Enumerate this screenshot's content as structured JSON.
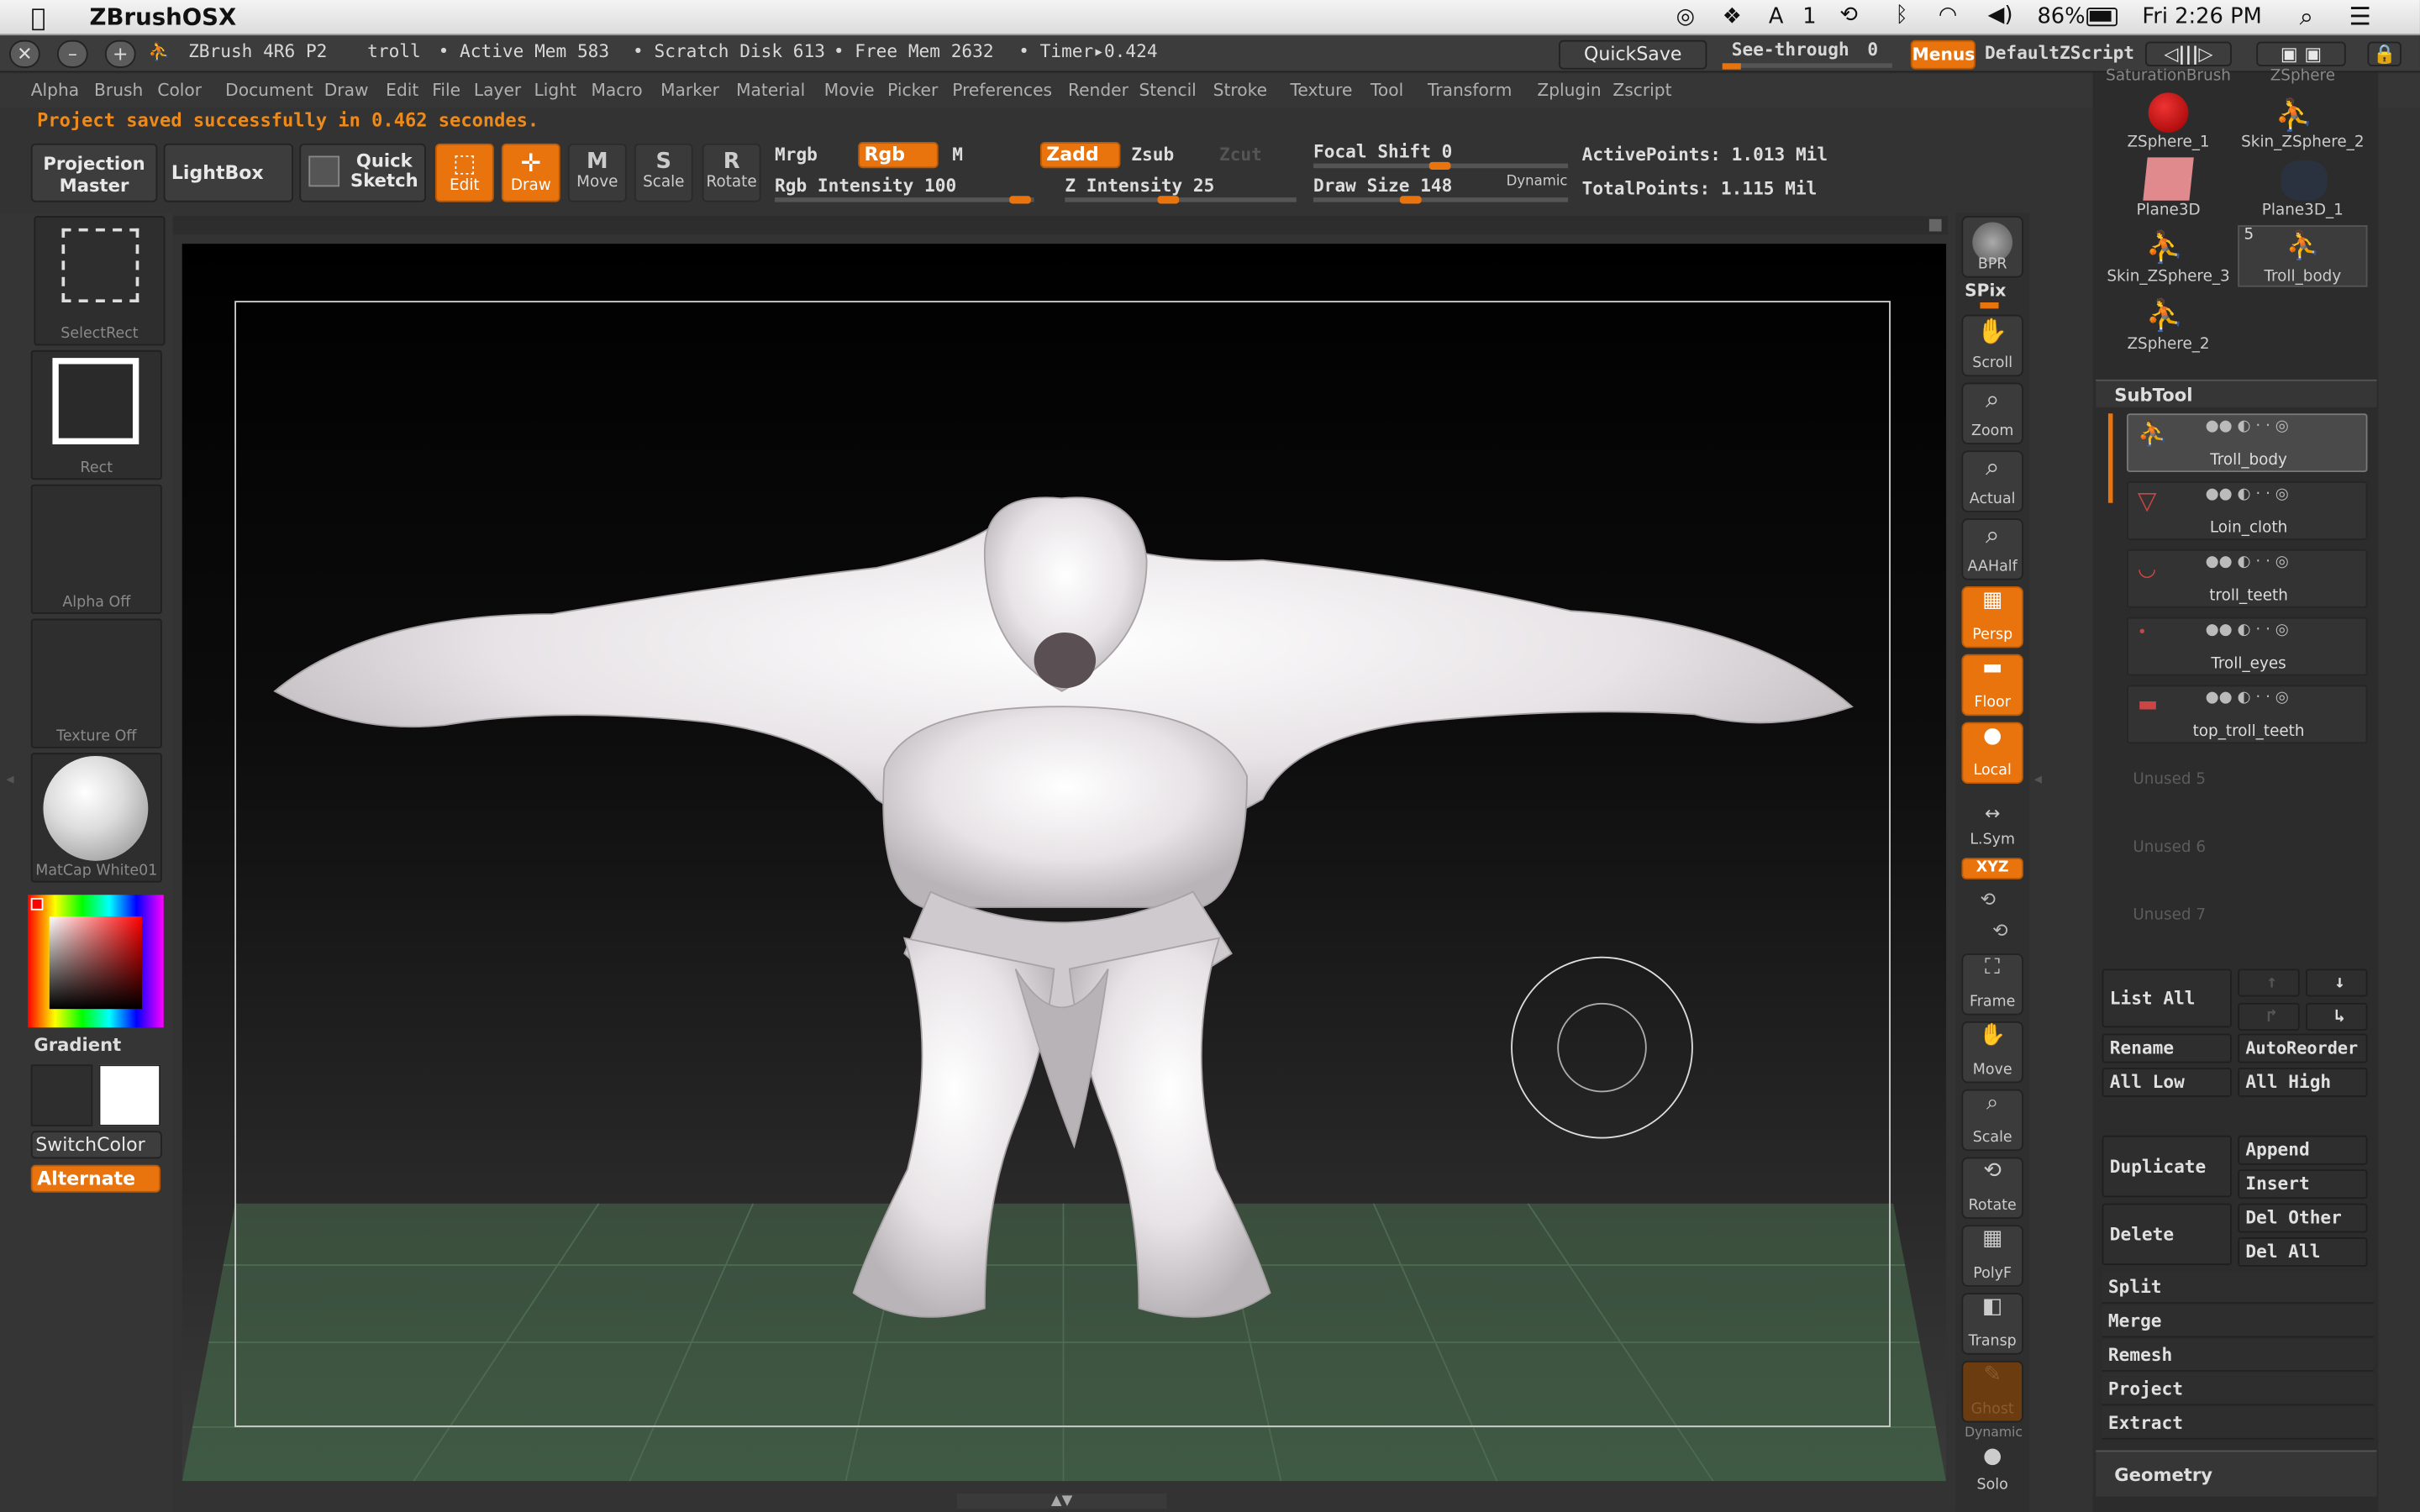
{
  "os_menubar": {
    "app_name": "ZBrushOSX",
    "notif": "1",
    "battery": "86%",
    "clock": "Fri 2:26 PM"
  },
  "titlebar": {
    "version": "ZBrush 4R6 P2",
    "doc": "troll",
    "active_mem": "• Active Mem 583",
    "scratch": "• Scratch Disk 613",
    "free_mem": "• Free Mem 2632",
    "timer": "• Timer▸0.424",
    "quicksave": "QuickSave",
    "see_through": "See-through",
    "see_through_val": "0",
    "menus": "Menus",
    "script": "DefaultZScript"
  },
  "menus": [
    "Alpha",
    "Brush",
    "Color",
    "Document",
    "Draw",
    "Edit",
    "File",
    "Layer",
    "Light",
    "Macro",
    "Marker",
    "Material",
    "Movie",
    "Picker",
    "Preferences",
    "Render",
    "Stencil",
    "Stroke",
    "Texture",
    "Tool",
    "Transform",
    "Zplugin",
    "Zscript"
  ],
  "status": "Project saved successfully in 0.462 secondes.",
  "toolbar": {
    "projection_master": "Projection Master",
    "lightbox": "LightBox",
    "quick_sketch": "Quick Sketch",
    "edit": "Edit",
    "draw": "Draw",
    "move": "Move",
    "scale": "Scale",
    "rotate": "Rotate",
    "mrgb": "Mrgb",
    "rgb": "Rgb",
    "m": "M",
    "zadd": "Zadd",
    "zsub": "Zsub",
    "zcut": "Zcut",
    "rgb_intensity": "Rgb Intensity 100",
    "z_intensity": "Z Intensity 25",
    "focal_shift": "Focal Shift 0",
    "draw_size": "Draw Size 148",
    "dynamic": "Dynamic",
    "active_points": "ActivePoints: 1.013 Mil",
    "total_points": "TotalPoints: 1.115 Mil"
  },
  "left": {
    "selectrect": "SelectRect",
    "rect": "Rect",
    "alpha": "Alpha Off",
    "texture": "Texture Off",
    "matcap": "MatCap White01",
    "gradient": "Gradient",
    "switchcolor": "SwitchColor",
    "alternate": "Alternate"
  },
  "right_tools": [
    {
      "name": "bpr",
      "label": "BPR"
    },
    {
      "name": "spix",
      "label": "SPix"
    },
    {
      "name": "scroll",
      "label": "Scroll"
    },
    {
      "name": "zoom",
      "label": "Zoom"
    },
    {
      "name": "actual",
      "label": "Actual"
    },
    {
      "name": "aahalf",
      "label": "AAHalf"
    },
    {
      "name": "persp",
      "label": "Persp"
    },
    {
      "name": "floor",
      "label": "Floor"
    },
    {
      "name": "local",
      "label": "Local"
    },
    {
      "name": "lsym",
      "label": "L.Sym"
    },
    {
      "name": "xyz",
      "label": "XYZ"
    },
    {
      "name": "frame",
      "label": "Frame"
    },
    {
      "name": "move",
      "label": "Move"
    },
    {
      "name": "scale",
      "label": "Scale"
    },
    {
      "name": "rotate",
      "label": "Rotate"
    },
    {
      "name": "polyf",
      "label": "PolyF"
    },
    {
      "name": "transp",
      "label": "Transp"
    },
    {
      "name": "ghost",
      "label": "Ghost"
    },
    {
      "name": "solo",
      "label": "Solo"
    },
    {
      "name": "dynamic",
      "label": "Dynamic"
    }
  ],
  "tool_thumbs": {
    "top_left": "SaturationBrush",
    "top_right": "ZSphere",
    "items": [
      {
        "label": "ZSphere_1"
      },
      {
        "label": "Skin_ZSphere_2"
      },
      {
        "label": "Plane3D"
      },
      {
        "label": "Plane3D_1"
      },
      {
        "label": "Skin_ZSphere_3"
      },
      {
        "label": "Troll_body",
        "count": "5"
      },
      {
        "label": "ZSphere_2"
      }
    ]
  },
  "subtool": {
    "title": "SubTool",
    "items": [
      "Troll_body",
      "Loin_cloth",
      "troll_teeth",
      "Troll_eyes",
      "top_troll_teeth"
    ],
    "unused": [
      "Unused 5",
      "Unused 6",
      "Unused 7"
    ],
    "list_all": "List All",
    "rename": "Rename",
    "autoreorder": "AutoReorder",
    "all_low": "All Low",
    "all_high": "All High",
    "duplicate": "Duplicate",
    "append": "Append",
    "insert": "Insert",
    "delete": "Delete",
    "del_other": "Del Other",
    "del_all": "Del All",
    "split": "Split",
    "merge": "Merge",
    "remesh": "Remesh",
    "project": "Project",
    "extract": "Extract",
    "geometry": "Geometry"
  },
  "colors": {
    "accent": "#e9730c",
    "status": "#ee8a1a"
  }
}
